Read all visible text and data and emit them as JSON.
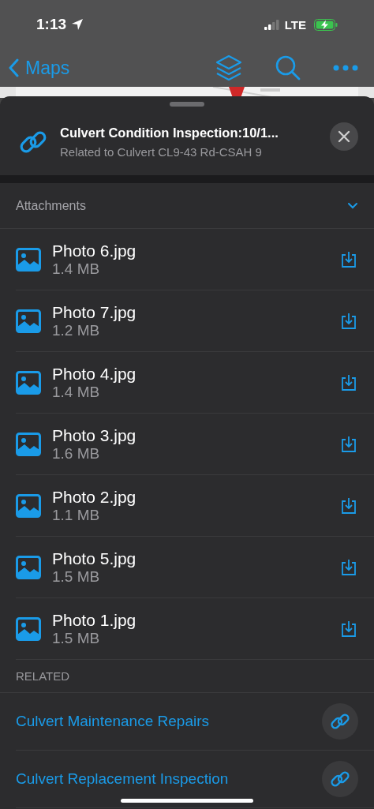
{
  "status_bar": {
    "time": "1:13",
    "network": "LTE"
  },
  "nav_bar": {
    "back_label": "Maps"
  },
  "sheet": {
    "title": "Culvert Condition Inspection:10/1...",
    "subtitle": "Related to Culvert CL9-43 Rd-CSAH 9"
  },
  "attachments": {
    "heading": "Attachments",
    "expanded": true,
    "items": [
      {
        "name": "Photo 6.jpg",
        "size": "1.4 MB"
      },
      {
        "name": "Photo 7.jpg",
        "size": "1.2 MB"
      },
      {
        "name": "Photo 4.jpg",
        "size": "1.4 MB"
      },
      {
        "name": "Photo 3.jpg",
        "size": "1.6 MB"
      },
      {
        "name": "Photo 2.jpg",
        "size": "1.1 MB"
      },
      {
        "name": "Photo 5.jpg",
        "size": "1.5 MB"
      },
      {
        "name": "Photo 1.jpg",
        "size": "1.5 MB"
      }
    ]
  },
  "related": {
    "heading": "RELATED",
    "items": [
      {
        "title": "Culvert Maintenance Repairs"
      },
      {
        "title": "Culvert Replacement Inspection"
      }
    ]
  }
}
